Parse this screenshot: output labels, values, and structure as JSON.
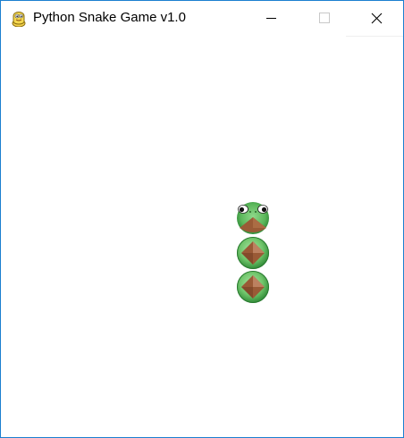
{
  "window": {
    "title": "Python Snake Game v1.0",
    "app_icon": "python-icon",
    "controls": {
      "minimize_icon": "minimize-icon",
      "maximize_icon": "maximize-icon",
      "close_icon": "close-icon"
    }
  },
  "game": {
    "background": "#ffffff",
    "snake": {
      "head_icon": "snake-head-icon",
      "body_icon": "snake-body-icon",
      "segment_count": 3,
      "colors": {
        "body": "#6fc46a",
        "body_dark": "#2f8a37",
        "diamond": "#9a5a36",
        "diamond_highlight": "#d8a383"
      }
    }
  }
}
